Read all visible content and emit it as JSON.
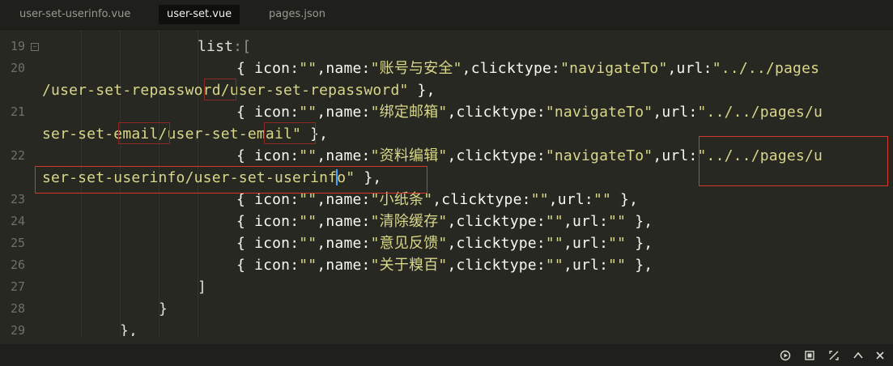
{
  "tabs": [
    {
      "label": "user-set-userinfo.vue"
    },
    {
      "label": "user-set.vue"
    },
    {
      "label": "pages.json"
    }
  ],
  "gutter": [
    "19",
    "20",
    "21",
    "22",
    "23",
    "24",
    "25",
    "26",
    "27",
    "28",
    "29"
  ],
  "code": {
    "l19": {
      "kw": "list",
      "punct": ":["
    },
    "l20a": {
      "pre": "{ icon:",
      "q1": "\"\"",
      "mid1": ",name:",
      "name": "\"账号与安全\"",
      "mid2": ",clicktype:",
      "type": "\"navigateTo\"",
      "mid3": ",url:",
      "url_a": "\"../../pages"
    },
    "l20b": {
      "url_b": "/user-set-repassword/user-set-repassword\"",
      "end": " },"
    },
    "l21a": {
      "pre": "{ icon:",
      "q1": "\"\"",
      "mid1": ",name:",
      "name": "\"绑定邮箱\"",
      "mid2": ",clicktype:",
      "type": "\"navigateTo\"",
      "mid3": ",url:",
      "url_a": "\"../../pages/u"
    },
    "l21b": {
      "url_b": "ser-set-email/user-set-email\"",
      "end": " },"
    },
    "l22a": {
      "pre": "{ icon:",
      "q1": "\"\"",
      "mid1": ",name:",
      "name": "\"资料编辑\"",
      "mid2": ",clicktype:",
      "type": "\"navigateTo\"",
      "mid3": ",url:",
      "url_a": "\"../../pages/u"
    },
    "l22b": {
      "url_b1": "ser-set-userinfo/user-set-userinf",
      "url_b2": "o\"",
      "end": " },"
    },
    "l23": {
      "pre": "{ icon:",
      "q1": "\"\"",
      "mid1": ",name:",
      "name": "\"小纸条\"",
      "mid2": ",clicktype:",
      "type": "\"\"",
      "mid3": ",url:",
      "url": "\"\"",
      "end": " },"
    },
    "l24": {
      "pre": "{ icon:",
      "q1": "\"\"",
      "mid1": ",name:",
      "name": "\"清除缓存\"",
      "mid2": ",clicktype:",
      "type": "\"\"",
      "mid3": ",url:",
      "url": "\"\"",
      "end": " },"
    },
    "l25": {
      "pre": "{ icon:",
      "q1": "\"\"",
      "mid1": ",name:",
      "name": "\"意见反馈\"",
      "mid2": ",clicktype:",
      "type": "\"\"",
      "mid3": ",url:",
      "url": "\"\"",
      "end": " },"
    },
    "l26": {
      "pre": "{ icon:",
      "q1": "\"\"",
      "mid1": ",name:",
      "name": "\"关于糗百\"",
      "mid2": ",clicktype:",
      "type": "\"\"",
      "mid3": ",url:",
      "url": "\"\"",
      "end": " },"
    },
    "l27": {
      "text": "]"
    },
    "l28": {
      "text": "}"
    },
    "l29": {
      "text": "},"
    }
  },
  "status_icons": [
    "run-icon",
    "stop-icon",
    "expand-icon",
    "chevron-up-icon",
    "close-icon"
  ],
  "colors": {
    "background": "#272822",
    "string": "#d8d78a",
    "highlight_box": "#d33a2c",
    "cursor": "#4aa3ff"
  }
}
